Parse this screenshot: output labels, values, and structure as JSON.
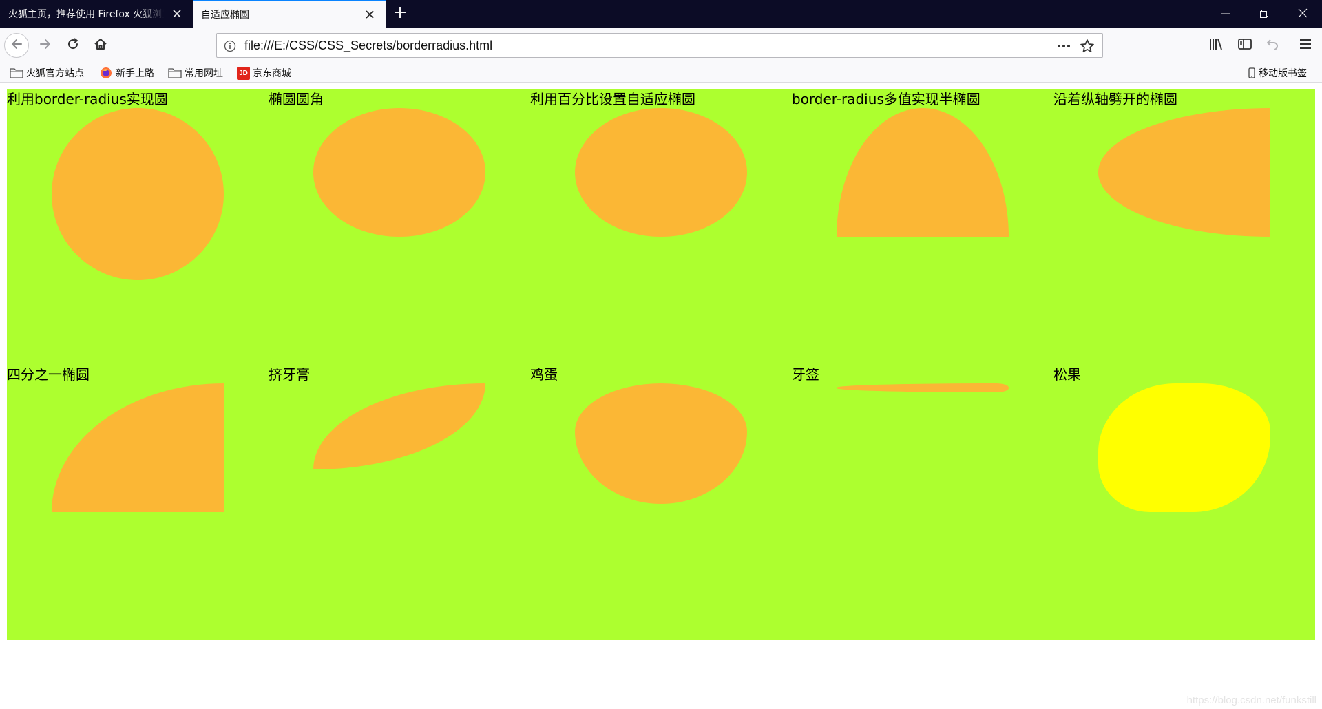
{
  "tabs": [
    {
      "title": "火狐主页，推荐使用 Firefox 火狐浏览器",
      "active": false
    },
    {
      "title": "自适应椭圆",
      "active": true
    }
  ],
  "address_bar": {
    "url": "file:///E:/CSS/CSS_Secrets/borderradius.html"
  },
  "bookmarks": [
    {
      "label": "火狐官方站点",
      "icon": "folder-icon"
    },
    {
      "label": "新手上路",
      "icon": "firefox-icon"
    },
    {
      "label": "常用网址",
      "icon": "folder-icon"
    },
    {
      "label": "京东商城",
      "icon": "jd-icon",
      "icon_text": "JD"
    }
  ],
  "mobile_bookmarks": {
    "label": "移动版书签",
    "icon": "mobile-icon"
  },
  "colors": {
    "page_bg": "#adff2f",
    "shape": "#fbb735",
    "pine_cone": "#ffff00",
    "active_tab_indicator": "#0a84ff",
    "tab_strip": "#0c0c26"
  },
  "demos": [
    {
      "label": "利用border-radius实现圆",
      "shape": "circle"
    },
    {
      "label": "椭圆圆角",
      "shape": "ellipse"
    },
    {
      "label": "利用百分比设置自适应椭圆",
      "shape": "ellipse-percent"
    },
    {
      "label": "border-radius多值实现半椭圆",
      "shape": "half-ellipse"
    },
    {
      "label": "沿着纵轴劈开的椭圆",
      "shape": "half-ellipse-vertical"
    },
    {
      "label": "四分之一椭圆",
      "shape": "quarter-ellipse"
    },
    {
      "label": "挤牙膏",
      "shape": "toothpaste"
    },
    {
      "label": "鸡蛋",
      "shape": "egg"
    },
    {
      "label": "牙签",
      "shape": "toothpick"
    },
    {
      "label": "松果",
      "shape": "pine-cone"
    }
  ],
  "watermark": "https://blog.csdn.net/funkstill"
}
